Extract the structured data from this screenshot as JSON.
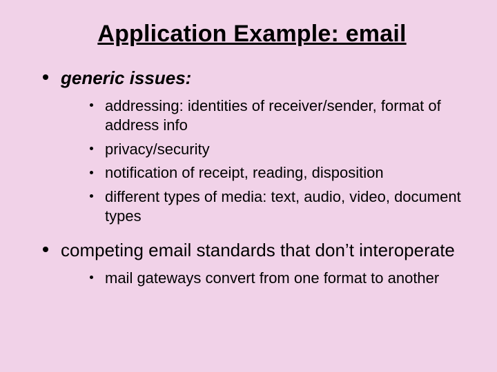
{
  "title": "Application Example: email",
  "items": [
    {
      "label": "generic issues:",
      "subhead": true,
      "children": [
        "addressing: identities of receiver/sender, format of address info",
        "privacy/security",
        "notification of receipt, reading, disposition",
        "different types of media: text, audio, video, document types"
      ]
    },
    {
      "label": "competing email standards that don’t interoperate",
      "subhead": false,
      "children": [
        "mail gateways convert from one format to another"
      ]
    }
  ]
}
